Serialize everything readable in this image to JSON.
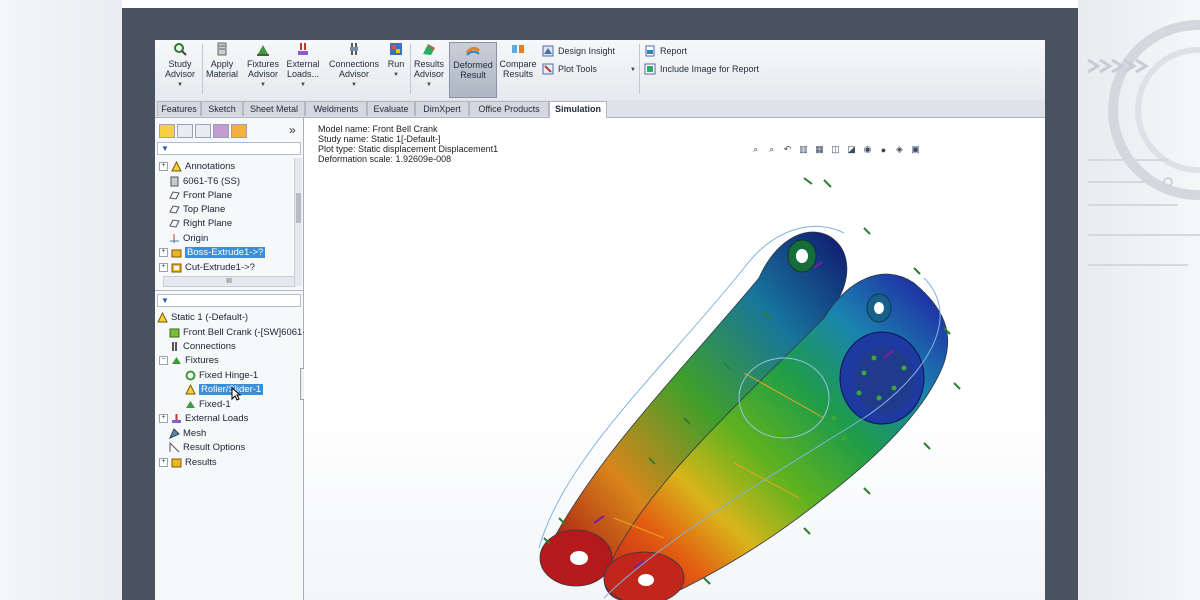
{
  "ribbon": {
    "buttons": [
      {
        "label1": "Study",
        "label2": "Advisor",
        "icon": "magnifier-study-icon"
      },
      {
        "label1": "Apply",
        "label2": "Material",
        "icon": "material-icon"
      },
      {
        "label1": "Fixtures",
        "label2": "Advisor",
        "icon": "fixtures-icon"
      },
      {
        "label1": "External",
        "label2": "Loads...",
        "icon": "external-loads-icon"
      },
      {
        "label1": "Connections",
        "label2": "Advisor",
        "icon": "connections-icon"
      },
      {
        "label1": "Run",
        "label2": "",
        "icon": "run-icon"
      },
      {
        "label1": "Results",
        "label2": "Advisor",
        "icon": "results-advisor-icon"
      },
      {
        "label1": "Deformed",
        "label2": "Result",
        "icon": "deformed-result-icon"
      },
      {
        "label1": "Compare",
        "label2": "Results",
        "icon": "compare-results-icon"
      }
    ],
    "small": {
      "design_insight": "Design Insight",
      "plot_tools": "Plot Tools",
      "report": "Report",
      "include_image": "Include Image for Report"
    }
  },
  "tabs": [
    "Features",
    "Sketch",
    "Sheet Metal",
    "Weldments",
    "Evaluate",
    "DimXpert",
    "Office Products",
    "Simulation"
  ],
  "active_tab": "Simulation",
  "feature_tree": {
    "items": [
      "Annotations",
      "6061-T6 (SS)",
      "Front Plane",
      "Top Plane",
      "Right Plane",
      "Origin",
      "Boss-Extrude1->?",
      "Cut-Extrude1->?"
    ],
    "selected": "Boss-Extrude1->?"
  },
  "study_tree": {
    "items": [
      "Static 1 (-Default-)",
      "Front Bell Crank (-[SW]6061-",
      "Connections",
      "Fixtures",
      "Fixed Hinge-1",
      "Roller/Slider-1",
      "Fixed-1",
      "External Loads",
      "Mesh",
      "Result Options",
      "Results"
    ],
    "selected": "Roller/Slider-1"
  },
  "plot_info": {
    "model_name": "Model name: Front Bell Crank",
    "study_name": "Study name: Static 1[-Default-]",
    "plot_type": "Plot type: Static displacement Displacement1",
    "deformation_scale": "Deformation scale: 1.92609e-008"
  },
  "panel": {
    "collapse_glyph": "»",
    "scroll_glyph": "III"
  },
  "colors": {
    "accent": "#3b8fd8",
    "frame": "#4a5261",
    "ribbon_active": "#aeb7c4"
  }
}
